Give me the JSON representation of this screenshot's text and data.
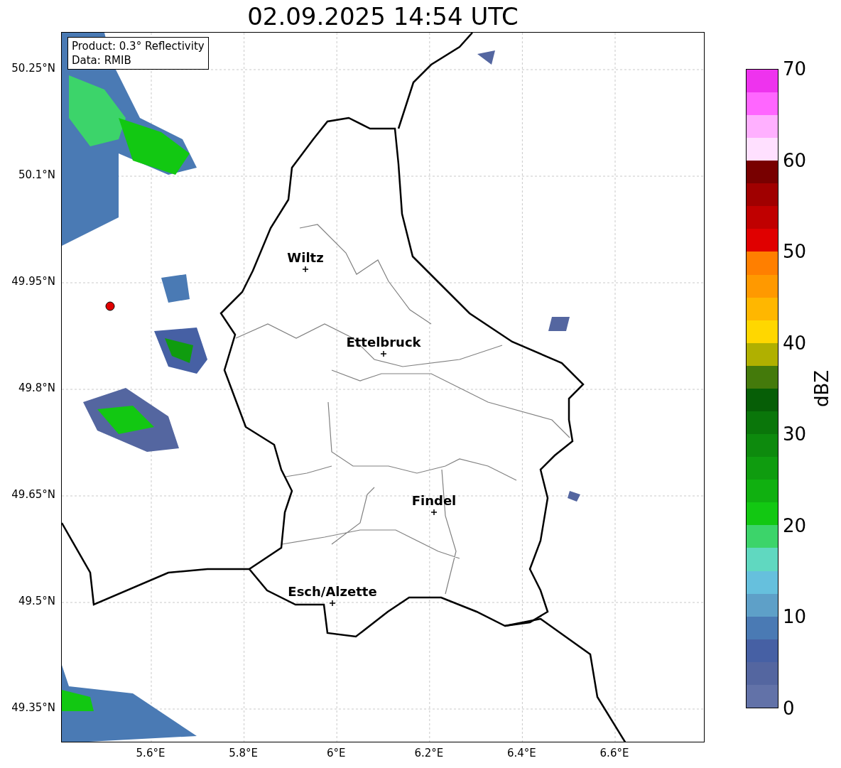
{
  "title": "02.09.2025 14:54 UTC",
  "info_box": [
    "Product: 0.3° Reflectivity",
    "Data: RMIB"
  ],
  "lat_ticks": [
    "50.25°N",
    "50.1°N",
    "49.95°N",
    "49.8°N",
    "49.65°N",
    "49.5°N",
    "49.35°N"
  ],
  "lon_ticks": [
    "5.6°E",
    "5.8°E",
    "6°E",
    "6.2°E",
    "6.4°E",
    "6.6°E"
  ],
  "cities": [
    {
      "name": "Wiltz"
    },
    {
      "name": "Ettelbruck"
    },
    {
      "name": "Findel"
    },
    {
      "name": "Esch/Alzette"
    }
  ],
  "colorbar": {
    "label": "dBZ",
    "ticks": [
      "70",
      "60",
      "50",
      "40",
      "30",
      "20",
      "10",
      "0"
    ],
    "segments": [
      {
        "color": "#6272a8"
      },
      {
        "color": "#5466a0"
      },
      {
        "color": "#4660a4"
      },
      {
        "color": "#4a7ab4"
      },
      {
        "color": "#5ea0c8"
      },
      {
        "color": "#66c0dd"
      },
      {
        "color": "#60d8c0"
      },
      {
        "color": "#3cd46a"
      },
      {
        "color": "#12c812"
      },
      {
        "color": "#10b010"
      },
      {
        "color": "#0f9c0f"
      },
      {
        "color": "#0d8a0d"
      },
      {
        "color": "#0a760a"
      },
      {
        "color": "#065e06"
      },
      {
        "color": "#447a0b"
      },
      {
        "color": "#b0b000"
      },
      {
        "color": "#ffd700"
      },
      {
        "color": "#ffb700"
      },
      {
        "color": "#ff9900"
      },
      {
        "color": "#ff7f00"
      },
      {
        "color": "#e00000"
      },
      {
        "color": "#c00000"
      },
      {
        "color": "#a00000"
      },
      {
        "color": "#780000"
      },
      {
        "color": "#ffe0ff"
      },
      {
        "color": "#ffb0ff"
      },
      {
        "color": "#ff66ff"
      },
      {
        "color": "#ee33ee"
      }
    ]
  }
}
